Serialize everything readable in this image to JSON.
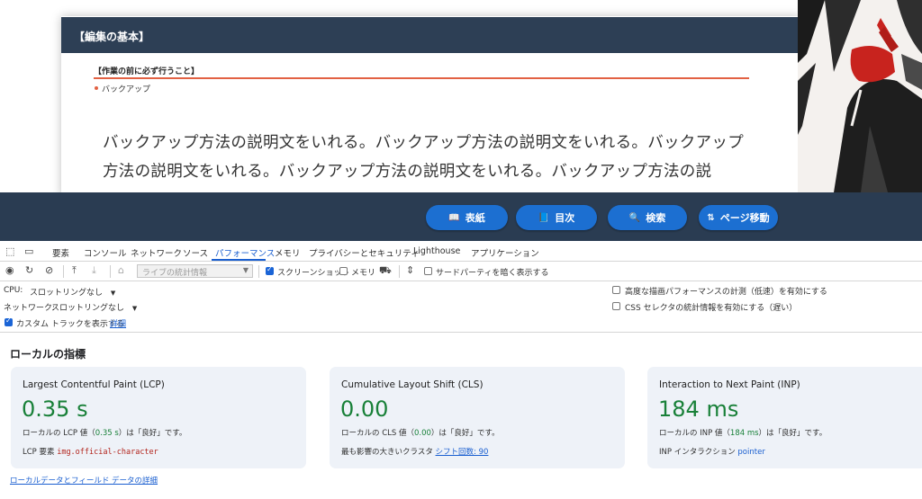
{
  "preview": {
    "card_title": "【編集の基本】",
    "note_title": "【作業の前に必ず行うこと】",
    "note_item": "バックアップ",
    "body_text": "バックアップ方法の説明文をいれる。バックアップ方法の説明文をいれる。バックアップ方法の説明文をいれる。バックアップ方法の説明文をいれる。バックアップ方法の説"
  },
  "navbar": {
    "buttons": [
      {
        "label": "表紙",
        "icon": "book-icon"
      },
      {
        "label": "目次",
        "icon": "list-icon"
      },
      {
        "label": "検索",
        "icon": "search-icon"
      },
      {
        "label": "ページ移動",
        "icon": "sort-arrows-icon",
        "glyph": "⇅"
      }
    ]
  },
  "devtools": {
    "tabs": [
      "要素",
      "コンソール",
      "ネットワーク",
      "ソース",
      "パフォーマンス",
      "メモリ",
      "プライバシーとセキュリティ",
      "Lighthouse",
      "アプリケーション"
    ],
    "active_tab": "パフォーマンス",
    "toolbar": {
      "live_stats_placeholder": "ライブの統計情報",
      "screenshot_label": "スクリーンショット",
      "screenshot_checked": true,
      "memory_label": "メモリ",
      "memory_checked": false,
      "third_party_label": "サードパーティを暗く表示する",
      "third_party_checked": false
    },
    "settings": {
      "cpu_label": "CPU:",
      "cpu_value": "スロットリングなし",
      "network_label": "ネットワーク:",
      "network_value": "スロットリングなし",
      "custom_track_label": "カスタム トラックを表示する",
      "custom_track_checked": true,
      "details_link": "詳細",
      "advanced_paint_label": "高度な描画パフォーマンスの計測（低速）を有効にする",
      "css_selector_label": "CSS セレクタの統計情報を有効にする（遅い）"
    },
    "metrics_title": "ローカルの指標",
    "metrics": [
      {
        "name": "Largest Contentful Paint (LCP)",
        "value": "0.35 s",
        "desc_prefix": "ローカルの LCP 値（",
        "desc_value": "0.35 s",
        "desc_suffix": "）は「良好」です。",
        "foot_label": "LCP 要素",
        "foot_value": "img.official-character"
      },
      {
        "name": "Cumulative Layout Shift (CLS)",
        "value": "0.00",
        "desc_prefix": "ローカルの CLS 値（",
        "desc_value": "0.00",
        "desc_suffix": "）は「良好」です。",
        "foot_label": "最も影響の大きいクラスタ",
        "foot_value": "シフト回数: 90"
      },
      {
        "name": "Interaction to Next Paint (INP)",
        "value": "184 ms",
        "desc_prefix": "ローカルの INP 値（",
        "desc_value": "184 ms",
        "desc_suffix": "）は「良好」です。",
        "foot_label": "INP インタラクション",
        "foot_value": "pointer"
      }
    ],
    "field_link": "ローカルデータとフィールド データの詳細"
  },
  "colors": {
    "header_bg": "#2d3f55",
    "nav_button": "#1c6fd1",
    "accent_line": "#e26143",
    "good_green": "#188038",
    "link_blue": "#1a5fd0"
  }
}
